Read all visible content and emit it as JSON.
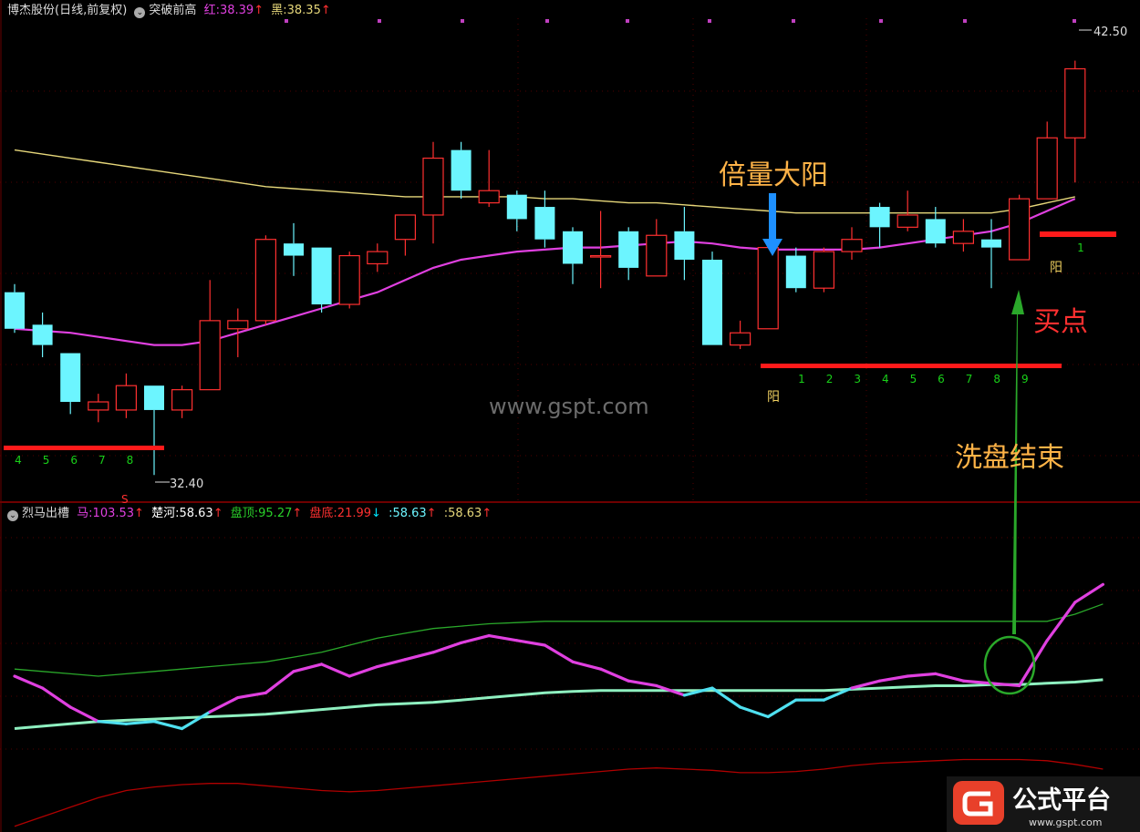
{
  "main_header": {
    "stock": "博杰股份(日线,前复权)",
    "indicator": "突破前高",
    "red_label": "红:",
    "red_value": "38.39",
    "black_label": "黑:",
    "black_value": "38.35"
  },
  "sub_header": {
    "indicator": "烈马出槽",
    "ma_label": "马:",
    "ma_value": "103.53",
    "chuhe_label": "楚河:",
    "chuhe_value": "58.63",
    "top_label": "盘顶:",
    "top_value": "95.27",
    "bottom_label": "盘底:",
    "bottom_value": "21.99",
    "v5_label": ":",
    "v5_value": "58.63",
    "v6_label": ":",
    "v6_value": "58.63"
  },
  "annotations": {
    "volume_yang": "倍量大阳",
    "buy_point": "买点",
    "wash_end": "洗盘结束",
    "watermark": "www.gspt.com",
    "high_price": "42.50",
    "low_price": "32.40",
    "yang_1": "阳",
    "yang_2": "阳",
    "s_mark": "S",
    "count_left": [
      "4",
      "5",
      "6",
      "7",
      "8"
    ],
    "count_mid": [
      "1",
      "2",
      "3",
      "4",
      "5",
      "6",
      "7",
      "8",
      "9"
    ],
    "count_right": [
      "1"
    ]
  },
  "logo": {
    "title": "公式平台",
    "url": "www.gspt.com"
  },
  "colors": {
    "up": "#ff3030",
    "down": "#6cf5ff",
    "ma_slow": "#e6d77a",
    "ma_fast": "#e040e0",
    "grid": "#6a0000",
    "red_bar": "#ff1a1a",
    "green_line": "#2aa82a",
    "count_text": "#19d119",
    "arrow_blue": "#1e90ff",
    "annot_orange": "#ffb347",
    "annot_red": "#ff3030"
  },
  "chart_data": [
    {
      "type": "candlestick",
      "ylim": [
        31.7,
        43.5
      ],
      "candles": [
        {
          "o": 36.8,
          "h": 37.0,
          "l": 35.8,
          "c": 35.9
        },
        {
          "o": 36.0,
          "h": 36.3,
          "l": 35.2,
          "c": 35.5
        },
        {
          "o": 35.3,
          "h": 35.3,
          "l": 33.8,
          "c": 34.1
        },
        {
          "o": 33.9,
          "h": 34.3,
          "l": 33.6,
          "c": 34.1
        },
        {
          "o": 33.9,
          "h": 34.8,
          "l": 33.7,
          "c": 34.5
        },
        {
          "o": 34.5,
          "h": 34.5,
          "l": 32.3,
          "c": 33.9
        },
        {
          "o": 33.9,
          "h": 34.5,
          "l": 33.7,
          "c": 34.4
        },
        {
          "o": 34.4,
          "h": 37.1,
          "l": 34.4,
          "c": 36.1
        },
        {
          "o": 35.9,
          "h": 36.4,
          "l": 35.2,
          "c": 36.1
        },
        {
          "o": 36.1,
          "h": 38.2,
          "l": 36.0,
          "c": 38.1
        },
        {
          "o": 38.0,
          "h": 38.5,
          "l": 37.2,
          "c": 37.7
        },
        {
          "o": 37.9,
          "h": 37.9,
          "l": 36.3,
          "c": 36.5
        },
        {
          "o": 36.5,
          "h": 37.8,
          "l": 36.4,
          "c": 37.7
        },
        {
          "o": 37.5,
          "h": 38.0,
          "l": 37.3,
          "c": 37.8
        },
        {
          "o": 38.1,
          "h": 38.7,
          "l": 37.7,
          "c": 38.7
        },
        {
          "o": 38.7,
          "h": 40.5,
          "l": 38.0,
          "c": 40.1
        },
        {
          "o": 40.3,
          "h": 40.5,
          "l": 39.1,
          "c": 39.3
        },
        {
          "o": 39.0,
          "h": 40.3,
          "l": 38.9,
          "c": 39.3
        },
        {
          "o": 39.2,
          "h": 39.3,
          "l": 38.3,
          "c": 38.6
        },
        {
          "o": 38.9,
          "h": 39.3,
          "l": 37.9,
          "c": 38.1
        },
        {
          "o": 38.3,
          "h": 38.4,
          "l": 37.0,
          "c": 37.5
        },
        {
          "o": 37.7,
          "h": 38.8,
          "l": 36.9,
          "c": 37.7
        },
        {
          "o": 38.3,
          "h": 38.4,
          "l": 37.1,
          "c": 37.4
        },
        {
          "o": 37.2,
          "h": 38.6,
          "l": 37.2,
          "c": 38.2
        },
        {
          "o": 38.3,
          "h": 38.9,
          "l": 37.1,
          "c": 37.6
        },
        {
          "o": 37.6,
          "h": 37.8,
          "l": 35.5,
          "c": 35.5
        },
        {
          "o": 35.5,
          "h": 36.1,
          "l": 35.4,
          "c": 35.8
        },
        {
          "o": 35.9,
          "h": 38.1,
          "l": 35.9,
          "c": 37.9
        },
        {
          "o": 37.7,
          "h": 37.9,
          "l": 36.8,
          "c": 36.9
        },
        {
          "o": 36.9,
          "h": 37.9,
          "l": 36.8,
          "c": 37.8
        },
        {
          "o": 37.8,
          "h": 38.4,
          "l": 37.6,
          "c": 38.1
        },
        {
          "o": 38.9,
          "h": 39.0,
          "l": 37.9,
          "c": 38.4
        },
        {
          "o": 38.4,
          "h": 39.3,
          "l": 38.3,
          "c": 38.7
        },
        {
          "o": 38.6,
          "h": 38.9,
          "l": 37.9,
          "c": 38.0
        },
        {
          "o": 38.0,
          "h": 38.6,
          "l": 37.8,
          "c": 38.3
        },
        {
          "o": 38.1,
          "h": 38.6,
          "l": 36.9,
          "c": 37.9
        },
        {
          "o": 37.6,
          "h": 39.2,
          "l": 37.6,
          "c": 39.1
        },
        {
          "o": 39.1,
          "h": 41.0,
          "l": 39.1,
          "c": 40.6
        },
        {
          "o": 40.6,
          "h": 42.5,
          "l": 39.5,
          "c": 42.3
        }
      ],
      "ma_slow": [
        40.3,
        40.2,
        40.1,
        40.0,
        39.9,
        39.8,
        39.7,
        39.6,
        39.5,
        39.4,
        39.35,
        39.3,
        39.25,
        39.2,
        39.15,
        39.15,
        39.15,
        39.15,
        39.15,
        39.1,
        39.1,
        39.05,
        39.0,
        39.0,
        38.95,
        38.9,
        38.85,
        38.8,
        38.75,
        38.75,
        38.75,
        38.75,
        38.75,
        38.75,
        38.75,
        38.75,
        38.85,
        39.0,
        39.15
      ],
      "ma_fast": [
        35.9,
        35.85,
        35.8,
        35.7,
        35.6,
        35.5,
        35.5,
        35.6,
        35.8,
        36.0,
        36.2,
        36.4,
        36.6,
        36.8,
        37.1,
        37.4,
        37.6,
        37.7,
        37.8,
        37.85,
        37.9,
        37.9,
        37.95,
        38.0,
        38.05,
        38.0,
        37.9,
        37.85,
        37.85,
        37.85,
        37.85,
        37.9,
        38.0,
        38.1,
        38.2,
        38.3,
        38.5,
        38.8,
        39.1
      ]
    },
    {
      "type": "line",
      "ylim": [
        0,
        130
      ],
      "series": [
        {
          "name": "马",
          "values": [
            65,
            60,
            52,
            46,
            45,
            46,
            43,
            50,
            56,
            58,
            67,
            70,
            65,
            69,
            72,
            75,
            79,
            82,
            80,
            78,
            71,
            68,
            63,
            61,
            57,
            60,
            52,
            48,
            55,
            55,
            60,
            63,
            65,
            66,
            63,
            62,
            61,
            80,
            96,
            103.5
          ]
        },
        {
          "name": "楚河",
          "values": [
            43,
            44,
            45,
            46,
            46.5,
            47,
            47.5,
            48,
            48.5,
            49,
            50,
            51,
            52,
            53,
            53.5,
            54,
            55,
            56,
            57,
            58,
            58.6,
            59,
            59,
            59,
            59,
            59,
            59,
            59,
            59,
            59,
            59.5,
            60,
            60.5,
            61,
            61,
            61.5,
            61.5,
            62,
            62.5,
            63.5
          ]
        },
        {
          "name": "盘顶",
          "values": [
            68,
            67,
            66,
            65,
            66,
            67,
            68,
            69,
            70,
            71,
            73,
            75,
            78,
            81,
            83,
            85,
            86,
            87,
            87.5,
            88,
            88,
            88,
            88,
            88,
            88,
            88,
            88,
            88,
            88,
            88,
            88,
            88,
            88,
            88,
            88,
            88,
            88,
            88,
            91,
            95.3
          ]
        },
        {
          "name": "盘底",
          "values": [
            2,
            6,
            10,
            14,
            17,
            18.5,
            19.5,
            20,
            20,
            19,
            18,
            17,
            16.5,
            17,
            18,
            19,
            20,
            21,
            22,
            23,
            24,
            25,
            26,
            26.5,
            26,
            25.5,
            24.5,
            24.5,
            25,
            26,
            27.5,
            28.5,
            29,
            29.5,
            30,
            30,
            30,
            29.5,
            28,
            26
          ]
        }
      ]
    }
  ]
}
